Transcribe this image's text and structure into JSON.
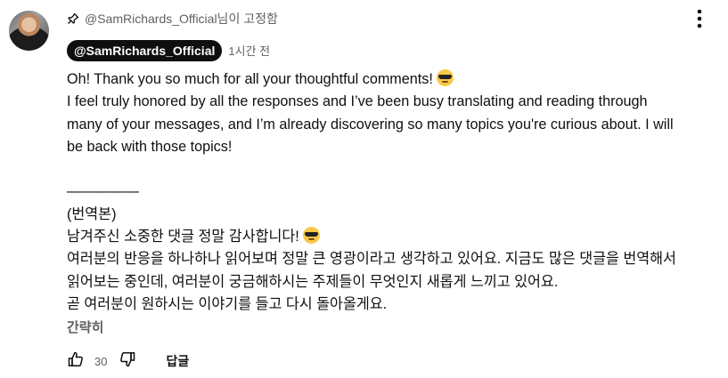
{
  "pinned": {
    "text": "@SamRichards_Official님이 고정함",
    "icon": "pin-icon"
  },
  "author": {
    "handle": "@SamRichards_Official",
    "timestamp": "1시간 전",
    "avatar_alt": "avatar"
  },
  "comment": {
    "line1": "Oh! Thank you so much for all your thoughtful comments!",
    "line2": "I feel truly honored by all the responses and I’ve been busy translating and reading through",
    "line3": "many of your messages, and I’m already discovering so many topics you're curious about. I will",
    "line4": "be back with those topics!",
    "divider": "—————",
    "line5": "(번역본)",
    "line6": "남겨주신 소중한 댓글 정말 감사합니다!",
    "line7": "여러분의 반응을 하나하나 읽어보며 정말 큰 영광이라고 생각하고 있어요. 지금도 많은 댓글을 번역해서",
    "line8": "읽어보는 중인데, 여러분이 궁금해하시는 주제들이 무엇인지 새롭게 느끼고 있어요.",
    "line9": "곧 여러분이 원하시는 이야기를 들고 다시 돌아올게요.",
    "emoji_icon": "sunglasses-emoji-icon"
  },
  "show_less_label": "간략히",
  "actions": {
    "like_count": "30",
    "reply_label": "답글"
  },
  "colors": {
    "text": "#0f0f0f",
    "secondary": "#606060",
    "badge_bg": "#0f0f0f"
  }
}
